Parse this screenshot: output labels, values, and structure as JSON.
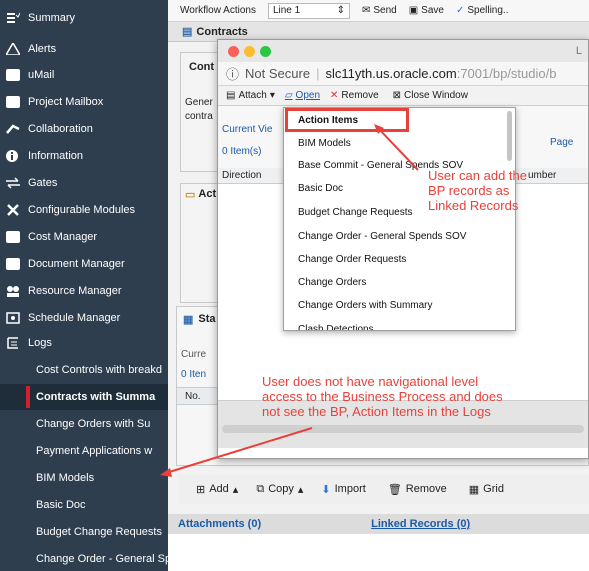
{
  "sidebar": {
    "items": [
      {
        "label": "Summary"
      },
      {
        "label": "Alerts"
      },
      {
        "label": "uMail"
      },
      {
        "label": "Project Mailbox"
      },
      {
        "label": "Collaboration"
      },
      {
        "label": "Information"
      },
      {
        "label": "Gates"
      },
      {
        "label": "Configurable Modules"
      },
      {
        "label": "Cost Manager"
      },
      {
        "label": "Document Manager"
      },
      {
        "label": "Resource Manager"
      },
      {
        "label": "Schedule Manager"
      },
      {
        "label": "Logs"
      }
    ],
    "logs": [
      {
        "label": "Cost Controls with breakd"
      },
      {
        "label": "Contracts with Summa"
      },
      {
        "label": "Change Orders with Su"
      },
      {
        "label": "Payment Applications w"
      },
      {
        "label": "BIM Models"
      },
      {
        "label": "Basic Doc"
      },
      {
        "label": "Budget Change Requests"
      },
      {
        "label": "Change Order - General Spends SOV"
      }
    ]
  },
  "app": {
    "toolbar": {
      "workflow_label": "Workflow Actions",
      "workflow_value": "Line 1",
      "send": "Send",
      "save": "Save",
      "spelling": "Spelling.."
    },
    "tab_title": "Contracts",
    "cont_label": "Cont",
    "gener_label": "Gener",
    "contra_label": "contra",
    "act_label": "Act",
    "sta_label": "Sta",
    "curre_label": "Curre",
    "items_zero": "0 Iten",
    "no_label": "No.",
    "attachments": "Attachments (0)",
    "linked_records": "Linked Records (0)"
  },
  "bottom_actions": {
    "add": "Add",
    "copy": "Copy",
    "import": "Import",
    "remove": "Remove",
    "grid": "Grid"
  },
  "popup": {
    "l_label": "L",
    "not_secure": "Not Secure",
    "domain": "slc11yth.us.oracle.com",
    "path": ":7001/bp/studio/b",
    "attach": "Attach",
    "open": "Open",
    "remove": "Remove",
    "close_window": "Close Window",
    "current_view": "Current Vie",
    "items_count": "0 Item(s)",
    "page": "Page",
    "direction": "Direction",
    "number_col": "umber"
  },
  "dropdown": {
    "items": [
      {
        "label": "Action Items"
      },
      {
        "label": "BIM Models"
      },
      {
        "label": "Base Commit - General Spends SOV"
      },
      {
        "label": "Basic Doc"
      },
      {
        "label": "Budget Change Requests"
      },
      {
        "label": "Change Order - General Spends SOV"
      },
      {
        "label": "Change Order Requests"
      },
      {
        "label": "Change Orders"
      },
      {
        "label": "Change Orders with Summary"
      },
      {
        "label": "Clash Detections"
      }
    ]
  },
  "annotations": {
    "linked_line1": "User can add the",
    "linked_line2": "BP records as",
    "linked_line3": "Linked Records",
    "nav_line1": "User does not have navigational level",
    "nav_line2": "access to the Business Process and does",
    "nav_line3": "not see the BP, Action Items in the Logs"
  },
  "colors": {
    "sidebar_bg": "#2e3e4e",
    "annotation_red": "#e8413a",
    "active_marker": "#d0202c",
    "link_blue": "#1a5aa8"
  },
  "icons": [
    "tasks-icon",
    "alert-icon",
    "mail-icon",
    "mailbox-icon",
    "collaboration-icon",
    "info-icon",
    "gates-icon",
    "modules-icon",
    "cost-icon",
    "document-icon",
    "resource-icon",
    "schedule-icon",
    "logs-icon"
  ]
}
